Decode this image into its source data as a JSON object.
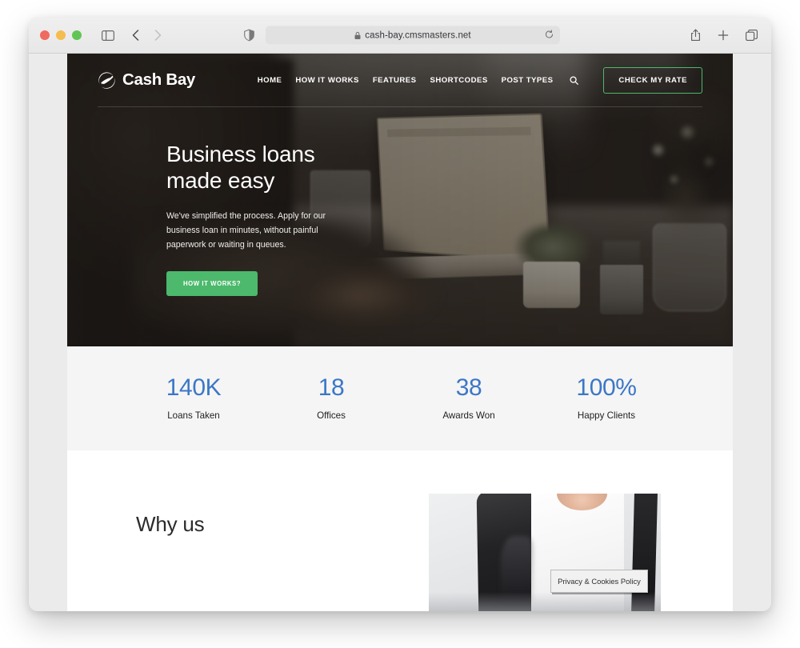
{
  "browser": {
    "url": "cash-bay.cmsmasters.net",
    "icons": {
      "traffic_close": "close-window-dot",
      "traffic_minimize": "minimize-window-dot",
      "traffic_zoom": "zoom-window-dot",
      "sidebar": "sidebar-toggle-icon",
      "back": "back-arrow-icon",
      "forward": "forward-arrow-icon",
      "shield": "privacy-shield-icon",
      "lock": "lock-icon",
      "reload": "reload-icon",
      "share": "share-icon",
      "new_tab": "plus-icon",
      "tab_overview": "tab-overview-icon"
    }
  },
  "site": {
    "header": {
      "logo_text": "Cash Bay",
      "logo_mark": "swoosh-circle-logo-icon",
      "nav": [
        {
          "label": "HOME"
        },
        {
          "label": "HOW IT WORKS"
        },
        {
          "label": "FEATURES"
        },
        {
          "label": "SHORTCODES"
        },
        {
          "label": "POST TYPES"
        }
      ],
      "search_icon": "search-icon",
      "cta_label": "CHECK MY RATE"
    },
    "hero": {
      "title_line1": "Business loans",
      "title_line2": "made easy",
      "subtitle": "We've simplified the process. Apply for our business loan in minutes, without painful paperwork or waiting in queues.",
      "button_label": "HOW IT WORKS?"
    },
    "stats": [
      {
        "value": "140K",
        "label": "Loans Taken"
      },
      {
        "value": "18",
        "label": "Offices"
      },
      {
        "value": "38",
        "label": "Awards Won"
      },
      {
        "value": "100%",
        "label": "Happy Clients"
      }
    ],
    "whyus": {
      "title": "Why us"
    },
    "cookie_banner": {
      "text": "Privacy & Cookies Policy"
    },
    "colors": {
      "accent_green": "#4cb96c",
      "stat_blue": "#3c77c6",
      "stats_band_bg": "#f5f5f5",
      "page_bg": "#ffffff",
      "viewport_bg": "#ebebeb"
    }
  }
}
